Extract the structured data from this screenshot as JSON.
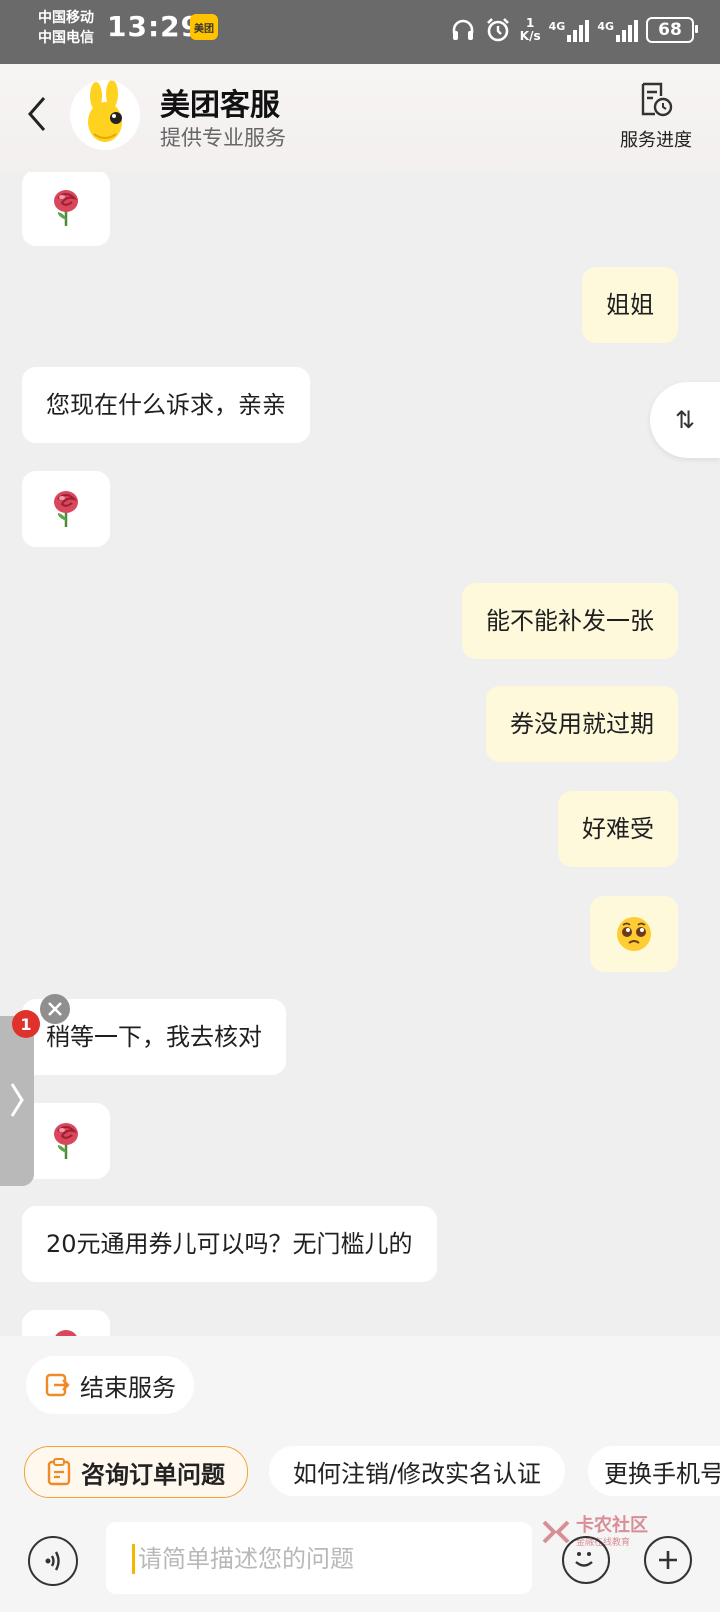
{
  "status_bar": {
    "carrier1": "中国移动",
    "carrier2": "中国电信",
    "time": "13:29",
    "app_badge": "美团",
    "speed_top": "1",
    "speed_unit": "K/s",
    "net1": "4G",
    "net2": "4G",
    "battery": "68"
  },
  "header": {
    "title": "美团客服",
    "subtitle": "提供专业服务",
    "progress_label": "服务进度"
  },
  "messages": [
    {
      "side": "in",
      "type": "rose",
      "text": ""
    },
    {
      "side": "out",
      "type": "text",
      "text": "姐姐"
    },
    {
      "side": "in",
      "type": "text",
      "text": "您现在什么诉求，亲亲"
    },
    {
      "side": "in",
      "type": "rose",
      "text": ""
    },
    {
      "side": "out",
      "type": "text",
      "text": "能不能补发一张"
    },
    {
      "side": "out",
      "type": "text",
      "text": "券没用就过期"
    },
    {
      "side": "out",
      "type": "text",
      "text": "好难受"
    },
    {
      "side": "out",
      "type": "emoji",
      "text": ""
    },
    {
      "side": "in",
      "type": "text",
      "text": "稍等一下，我去核对"
    },
    {
      "side": "in",
      "type": "rose",
      "text": ""
    },
    {
      "side": "in",
      "type": "text",
      "text": "20元通用券儿可以吗？无门槛儿的"
    },
    {
      "side": "in",
      "type": "rose",
      "text": ""
    }
  ],
  "floating": {
    "sort_icon": "⇅",
    "unread_count": "1"
  },
  "bottom": {
    "end_service": "结束服务",
    "quick_chips": [
      "咨询订单问题",
      "如何注销/修改实名认证",
      "更换手机号"
    ],
    "input_placeholder": "请简单描述您的问题",
    "watermark": "卡农社区",
    "watermark_sub": "金融在线教育"
  },
  "colors": {
    "outgoing_bubble": "#fff9dc",
    "incoming_bubble": "#ffffff",
    "accent": "#f0a43c",
    "brand_yellow": "#ffc300"
  }
}
